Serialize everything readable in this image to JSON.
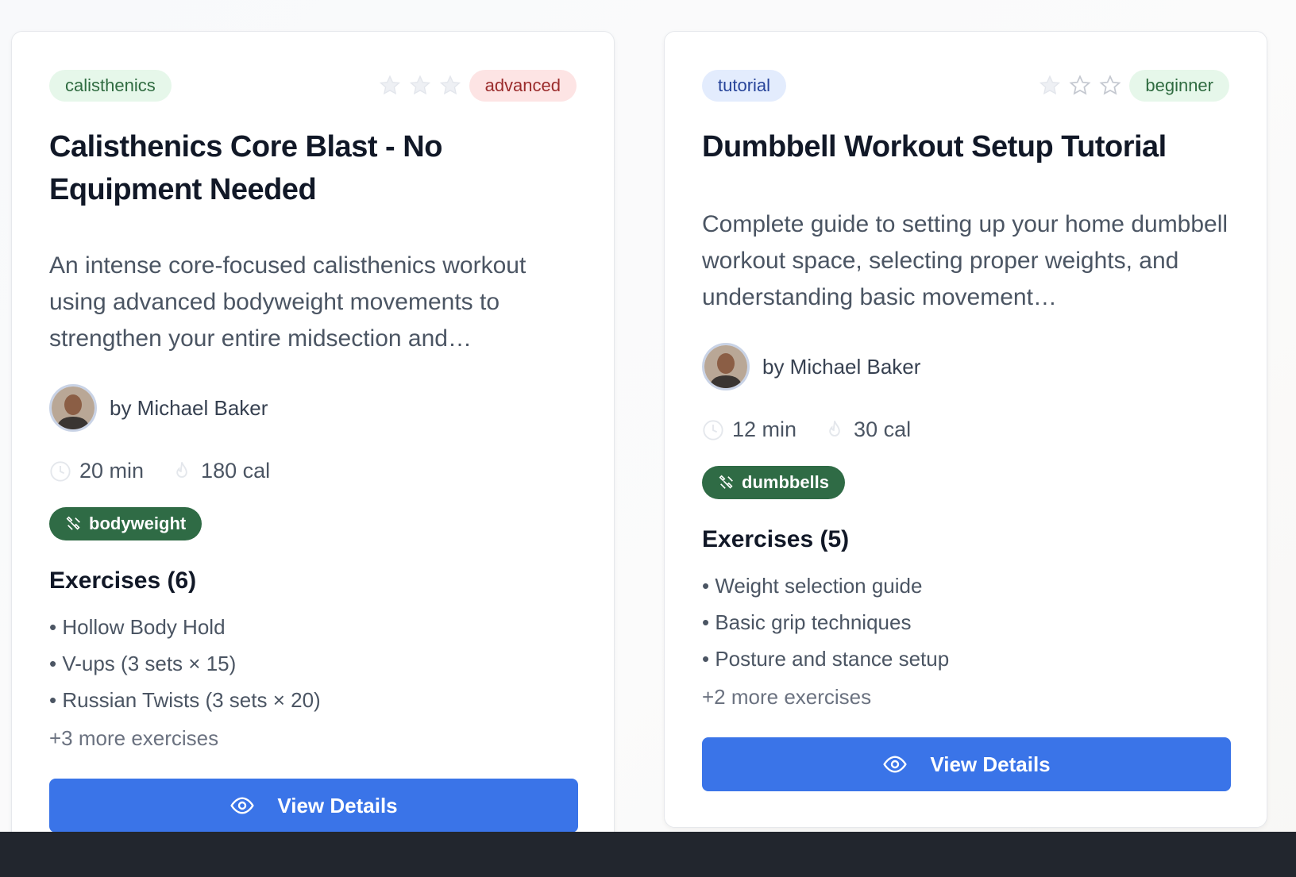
{
  "cards": [
    {
      "category": "calisthenics",
      "level": "advanced",
      "rating": 0,
      "title": "Calisthenics Core Blast - No Equipment Needed",
      "description": "An intense core-focused calisthenics workout using advanced bodyweight movements to strengthen your entire midsection and…",
      "author": "by Michael Baker",
      "duration": "20 min",
      "calories": "180 cal",
      "equipment": "bodyweight",
      "exercises_heading": "Exercises (6)",
      "exercises": [
        "• Hollow Body Hold",
        "• V-ups (3 sets × 15)",
        "• Russian Twists (3 sets × 20)"
      ],
      "more": "+3 more exercises",
      "button": "View Details"
    },
    {
      "category": "tutorial",
      "level": "beginner",
      "rating": 0,
      "title": "Dumbbell Workout Setup Tutorial",
      "description": "Complete guide to setting up your home dumbbell workout space, selecting proper weights, and understanding basic movement…",
      "author": "by Michael Baker",
      "duration": "12 min",
      "calories": "30 cal",
      "equipment": "dumbbells",
      "exercises_heading": "Exercises (5)",
      "exercises": [
        "• Weight selection guide",
        "• Basic grip techniques",
        "• Posture and stance setup"
      ],
      "more": "+2 more exercises",
      "button": "View Details"
    }
  ],
  "colors": {
    "primary_button": "#3a74e8",
    "equipment_badge": "#2f6b45",
    "footer": "#22262e"
  }
}
